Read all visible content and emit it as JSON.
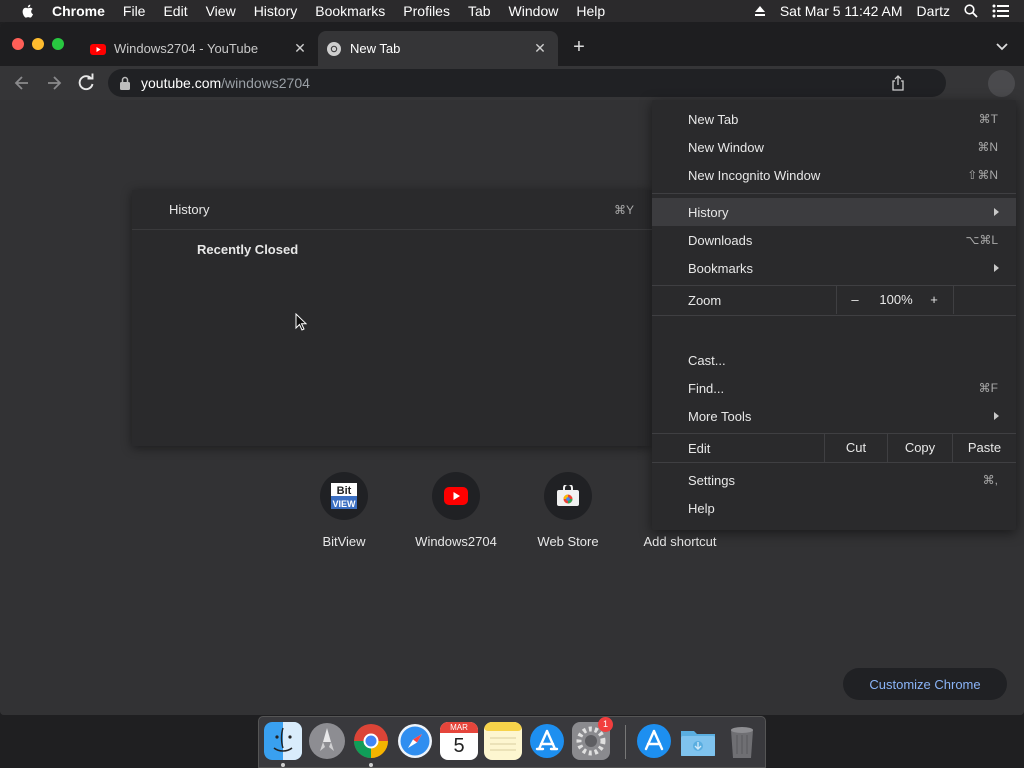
{
  "menubar": {
    "app_name": "Chrome",
    "items": [
      "File",
      "Edit",
      "View",
      "History",
      "Bookmarks",
      "Profiles",
      "Tab",
      "Window",
      "Help"
    ],
    "datetime": "Sat Mar 5  11:42 AM",
    "user": "Dartz"
  },
  "tabs": [
    {
      "title": "Windows2704 - YouTube",
      "icon": "youtube-icon"
    },
    {
      "title": "New Tab",
      "icon": "chrome-icon"
    }
  ],
  "omnibox": {
    "host": "youtube.com",
    "path": "/windows2704"
  },
  "history_submenu": {
    "title": "History",
    "shortcut": "⌘Y",
    "recently_closed": "Recently Closed"
  },
  "shortcuts": [
    {
      "label": "BitView",
      "icon": "bitview-icon"
    },
    {
      "label": "Windows2704",
      "icon": "youtube-icon"
    },
    {
      "label": "Web Store",
      "icon": "webstore-icon"
    },
    {
      "label": "Add shortcut",
      "icon": "plus-icon"
    }
  ],
  "customize_label": "Customize Chrome",
  "chrome_menu": {
    "new_tab": {
      "label": "New Tab",
      "shortcut": "⌘T"
    },
    "new_window": {
      "label": "New Window",
      "shortcut": "⌘N"
    },
    "new_incognito": {
      "label": "New Incognito Window",
      "shortcut": "⇧⌘N"
    },
    "history": {
      "label": "History"
    },
    "downloads": {
      "label": "Downloads",
      "shortcut": "⌥⌘L"
    },
    "bookmarks": {
      "label": "Bookmarks"
    },
    "zoom": {
      "label": "Zoom",
      "minus": "–",
      "value": "100%",
      "plus": "+"
    },
    "cast": {
      "label": "Cast..."
    },
    "find": {
      "label": "Find...",
      "shortcut": "⌘F"
    },
    "more_tools": {
      "label": "More Tools"
    },
    "edit": {
      "label": "Edit",
      "cut": "Cut",
      "copy": "Copy",
      "paste": "Paste"
    },
    "settings": {
      "label": "Settings",
      "shortcut": "⌘,"
    },
    "help": {
      "label": "Help"
    }
  },
  "dock": {
    "calendar_month": "MAR",
    "calendar_day": "5",
    "badge_count": "1"
  }
}
